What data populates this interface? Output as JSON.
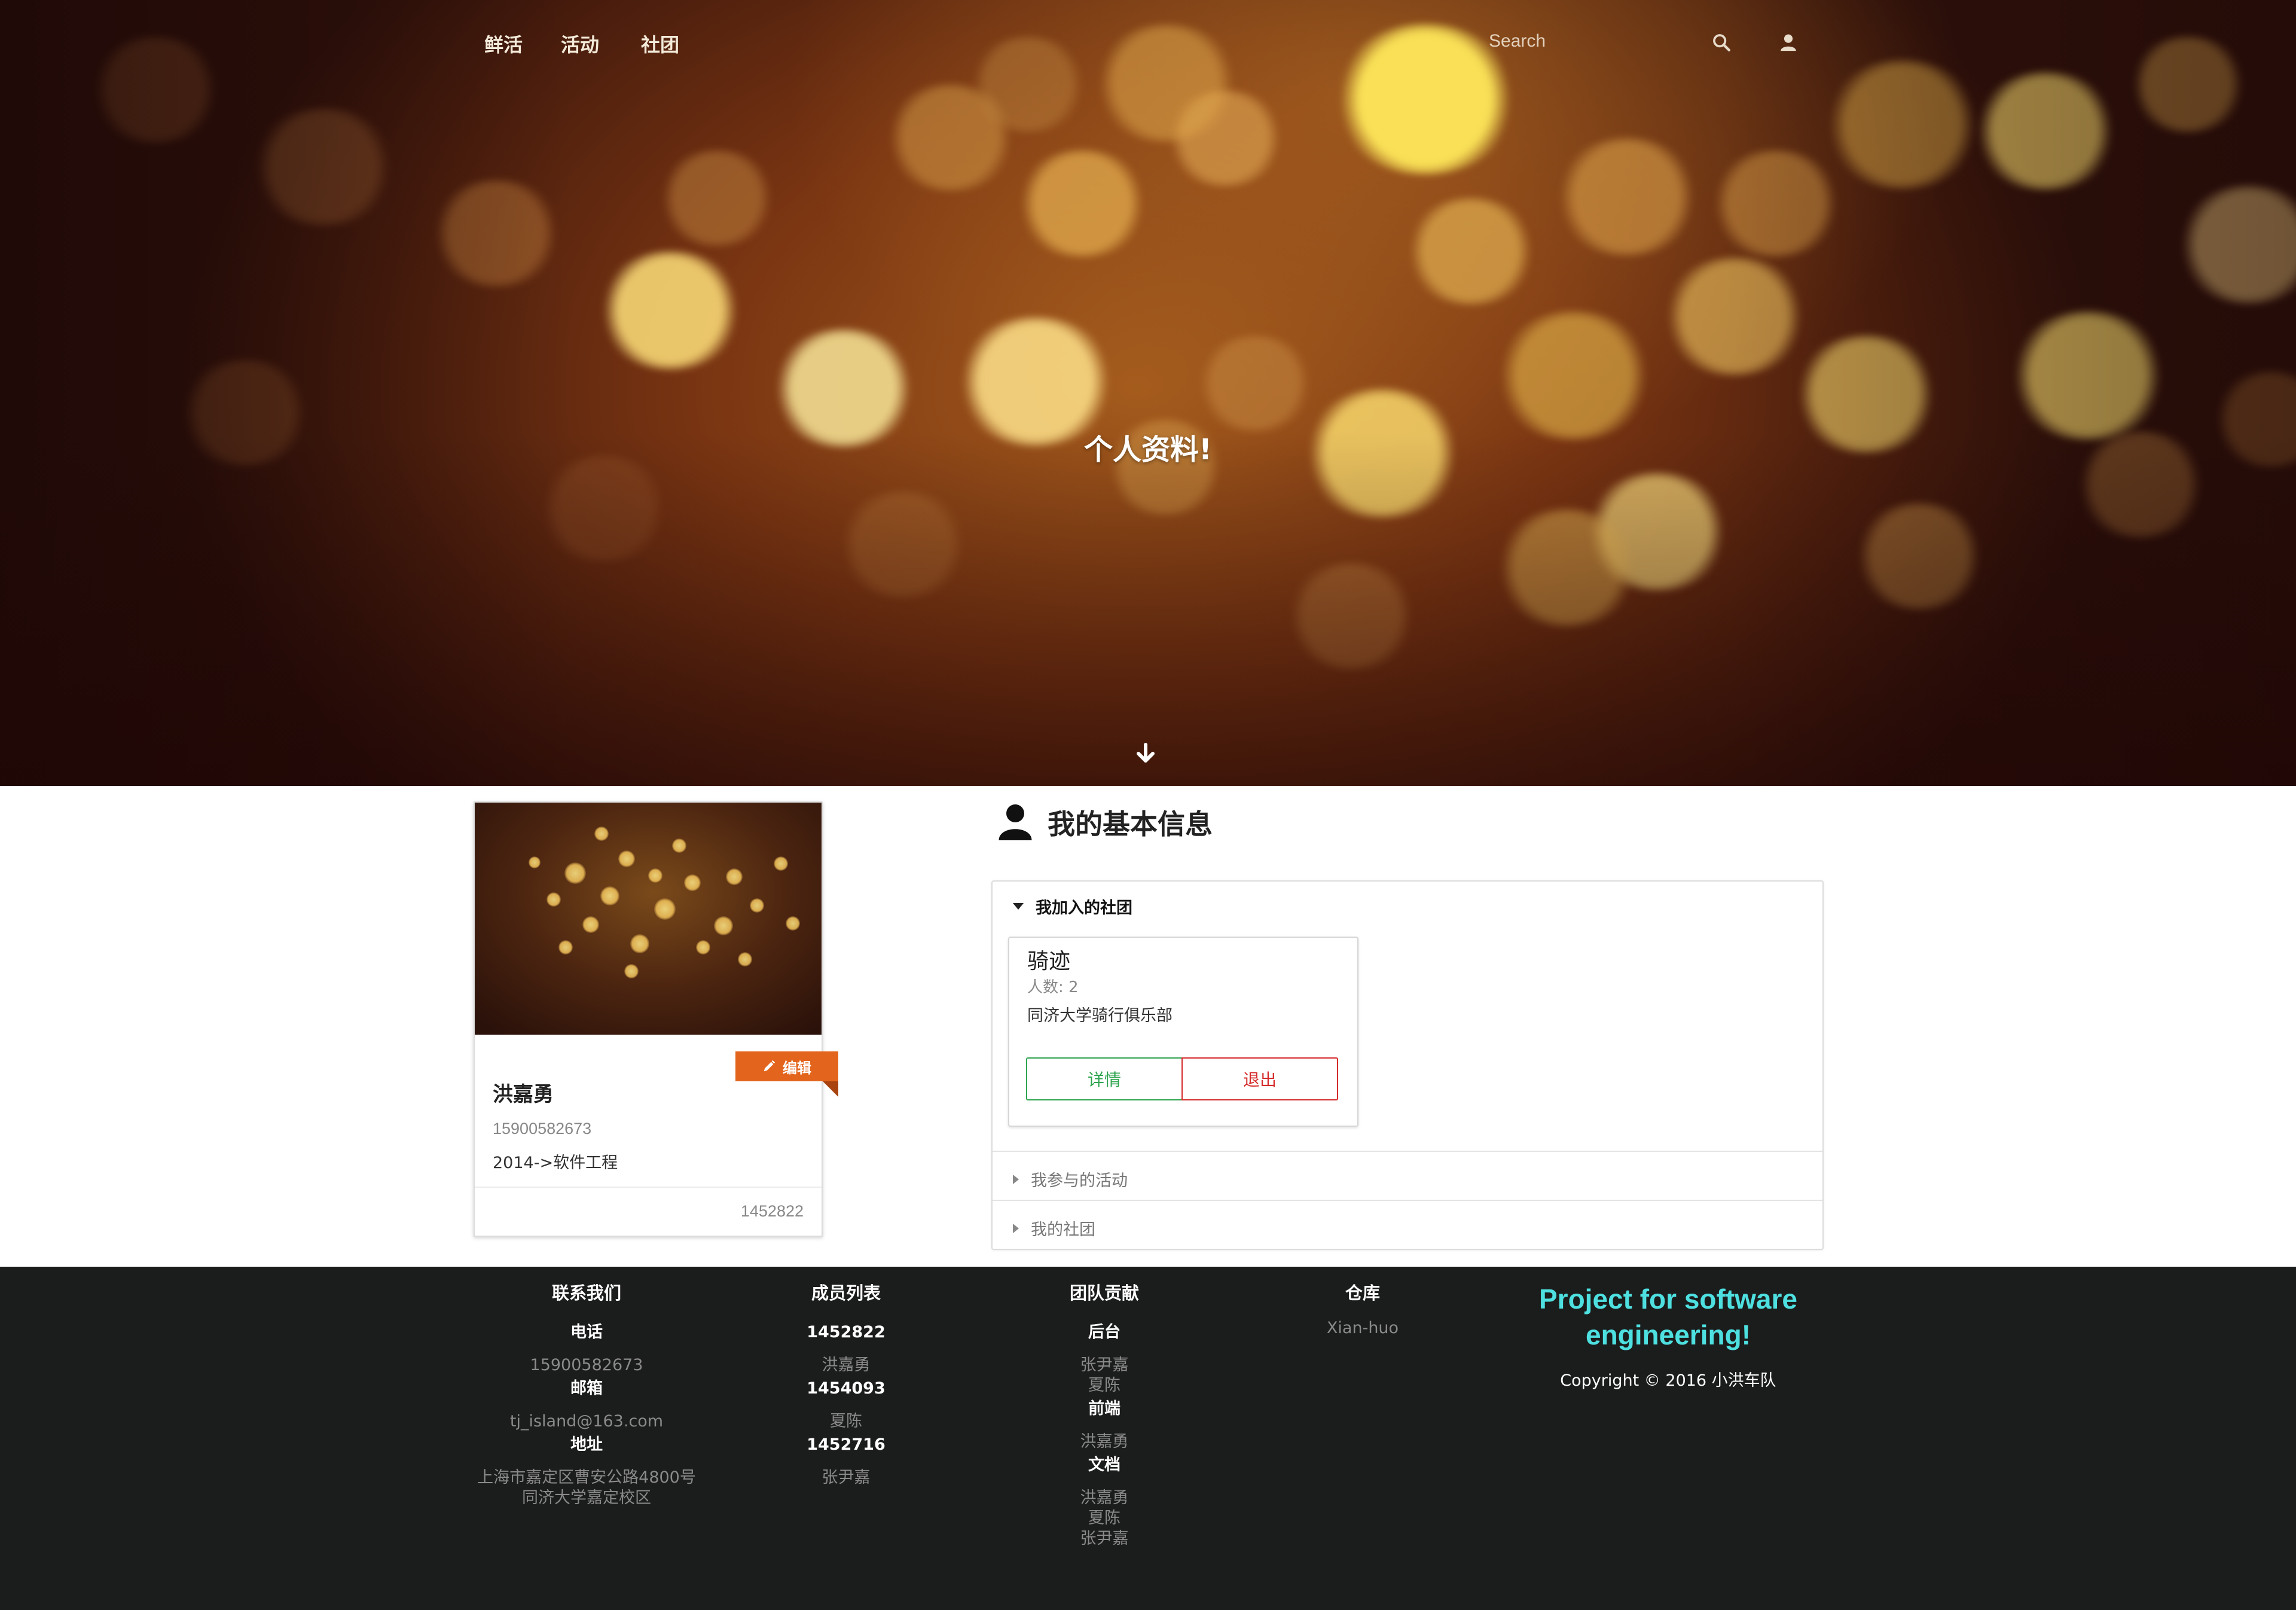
{
  "nav": {
    "links": [
      "鲜活",
      "活动",
      "社团"
    ],
    "search_placeholder": "Search"
  },
  "hero": {
    "title": "个人资料!"
  },
  "profile": {
    "edit_label": "编辑",
    "name": "洪嘉勇",
    "phone": "15900582673",
    "major": "2014->软件工程",
    "student_id": "1452822"
  },
  "info": {
    "title": "我的基本信息",
    "sections": {
      "joined_clubs": "我加入的社团",
      "activities": "我参与的活动",
      "my_clubs": "我的社团"
    },
    "club": {
      "name": "骑迹",
      "count": "人数: 2",
      "description": "同济大学骑行俱乐部",
      "detail_label": "详情",
      "quit_label": "退出"
    }
  },
  "footer": {
    "contact": {
      "heading": "联系我们",
      "phone_label": "电话",
      "phone": "15900582673",
      "email_label": "邮箱",
      "email": "tj_island@163.com",
      "address_label": "地址",
      "address_line1": "上海市嘉定区曹安公路4800号",
      "address_line2": "同济大学嘉定校区"
    },
    "members": {
      "heading": "成员列表",
      "list": [
        {
          "id": "1452822",
          "name": "洪嘉勇"
        },
        {
          "id": "1454093",
          "name": "夏陈"
        },
        {
          "id": "1452716",
          "name": "张尹嘉"
        }
      ]
    },
    "contrib": {
      "heading": "团队贡献",
      "groups": [
        {
          "role": "后台",
          "people": [
            "张尹嘉",
            "夏陈"
          ]
        },
        {
          "role": "前端",
          "people": [
            "洪嘉勇"
          ]
        },
        {
          "role": "文档",
          "people": [
            "洪嘉勇",
            "夏陈",
            "张尹嘉"
          ]
        }
      ]
    },
    "repo": {
      "heading": "仓库",
      "link": "Xian-huo"
    },
    "tagline": "Project for software engineering!",
    "copyright": "Copyright © 2016 小洪车队"
  },
  "colors": {
    "accent_orange": "#e3651d",
    "success_green": "#2ea44f",
    "danger_red": "#d62c2c",
    "footer_bg": "#1b1c1c",
    "tagline_cyan": "#4ee0e0"
  }
}
